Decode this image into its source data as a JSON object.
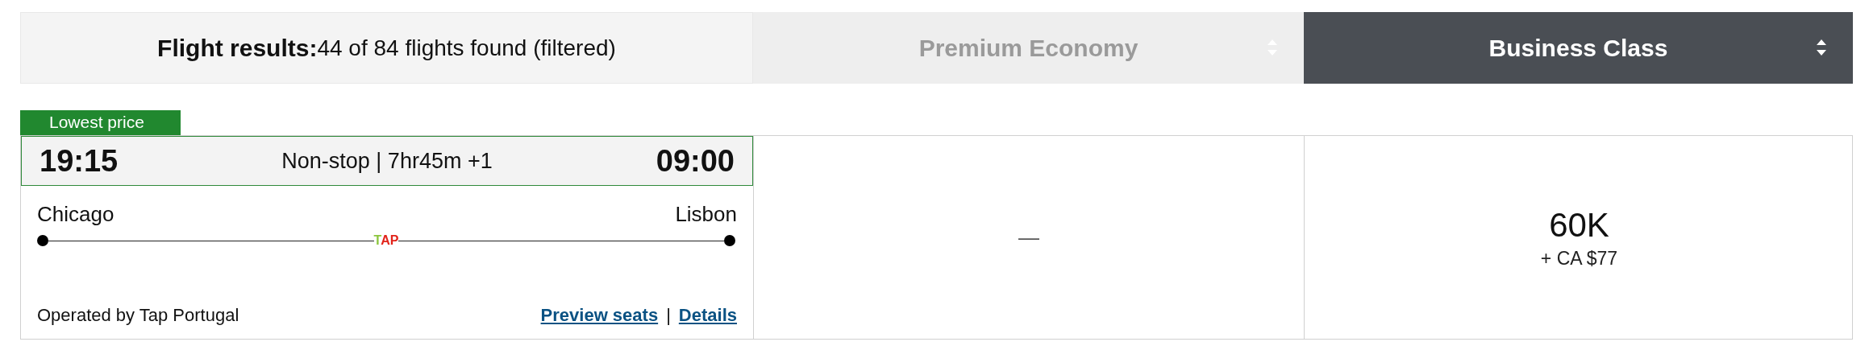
{
  "header": {
    "title": "Flight results:",
    "summary": "44 of 84 flights found (filtered)"
  },
  "cabin_columns": [
    {
      "label": "Premium Economy",
      "selected": false
    },
    {
      "label": "Business Class",
      "selected": true
    }
  ],
  "flight": {
    "badge": "Lowest price",
    "departure_time": "19:15",
    "info": "Non-stop | 7hr45m +1",
    "arrival_time": "09:00",
    "origin": "Chicago",
    "destination": "Lisbon",
    "airline_logo": "TAP",
    "operated_by": "Operated by Tap Portugal",
    "links": [
      "Preview seats",
      "Details"
    ],
    "link_separator": "|"
  },
  "fares": [
    {
      "kind": "none",
      "text": "—"
    },
    {
      "kind": "price",
      "points": "60K",
      "taxes": "+ CA $77"
    }
  ]
}
